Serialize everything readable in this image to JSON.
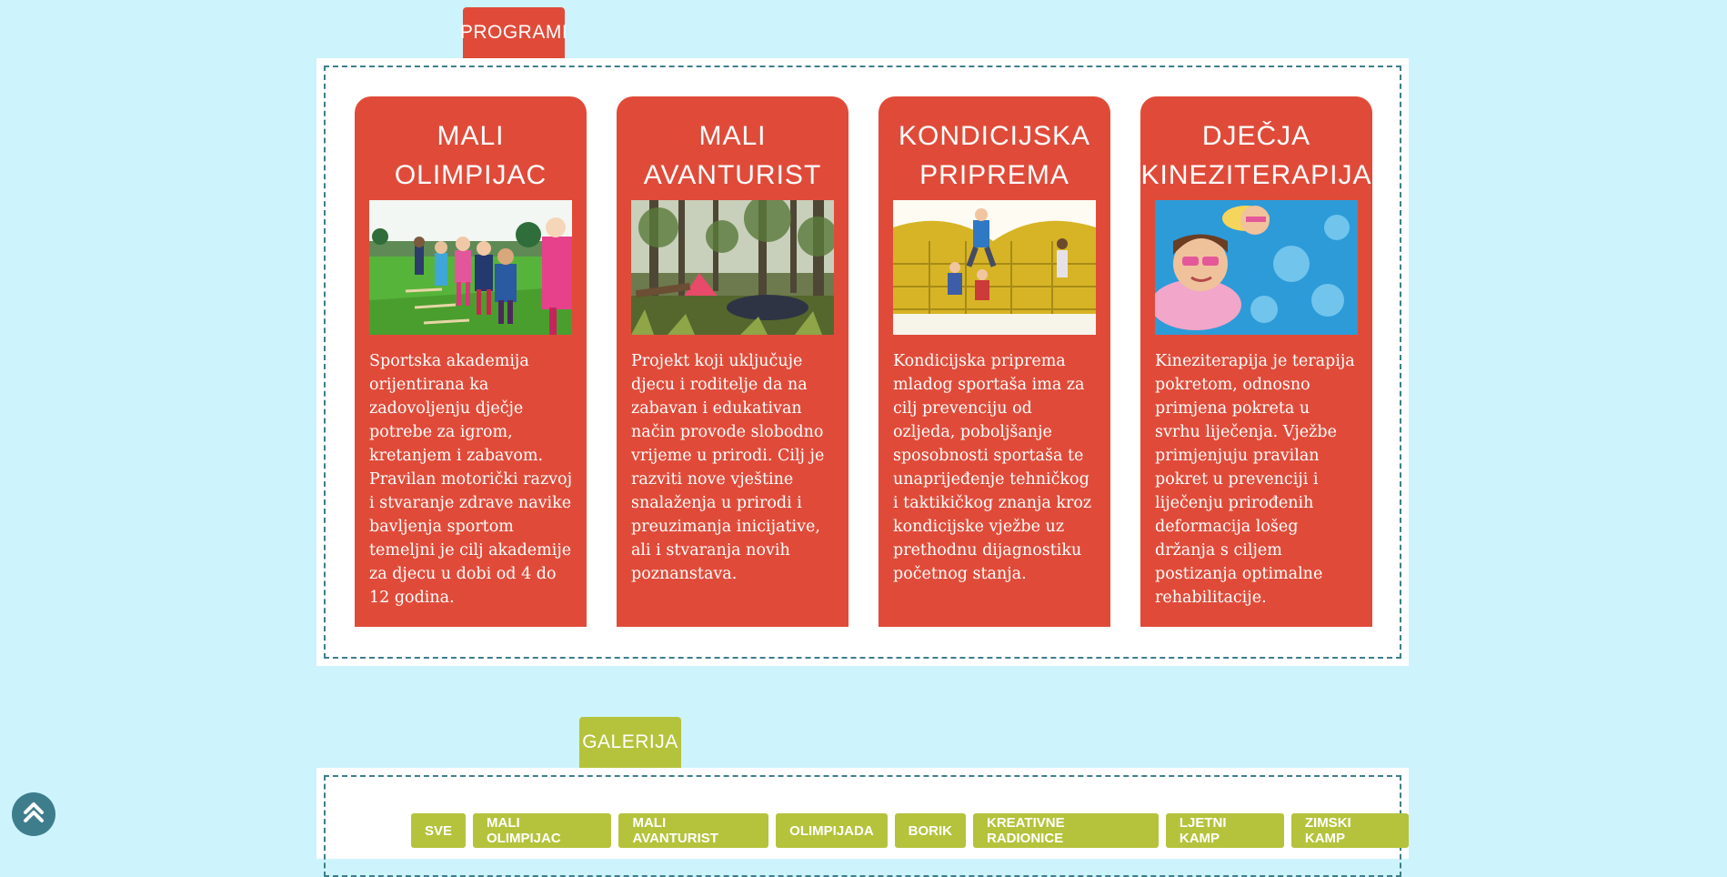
{
  "sections": {
    "programi_label": "PROGRAMI",
    "galerija_label": "GALERIJA"
  },
  "cards": [
    {
      "title_line1": "MALI",
      "title_line2": "OLIMPIJAC",
      "image": "children-on-grass-field",
      "text": "Sportska akademija orijentirana ka zadovoljenju dječje potrebe za igrom, kretanjem i zabavom. Pravilan motorički razvoj i stvaranje zdrave navike bavljenja sportom temeljni je cilj akademije za djecu u dobi od 4 do 12 godina."
    },
    {
      "title_line1": "MALI",
      "title_line2": "AVANTURIST",
      "image": "forest-camp-tent",
      "text": "Projekt koji uključuje djecu i roditelje da na zabavan i edukativan način provode slobodno vrijeme u prirodi. Cilj je razviti nove vještine snalaženja u prirodi i preuzimanja inicijative, ali i stvaranja novih poznanstava."
    },
    {
      "title_line1": "KONDICIJSKA",
      "title_line2": "PRIPREMA",
      "image": "bouncy-castle-jump",
      "text": "Kondicijska priprema mladog sportaša ima za cilj prevenciju od ozljeda, poboljšanje sposobnosti sportaša te unaprijeđenje tehničkog i taktikičkog znanja kroz kondicijske vježbe uz prethodnu dijagnostiku početnog stanja."
    },
    {
      "title_line1": "DJEČJA",
      "title_line2": "KINEZITERAPIJA",
      "image": "kids-in-pool",
      "text": "Kineziterapija je terapija pokretom, odnosno primjena pokreta u svrhu liječenja. Vježbe primjenjuju pravilan pokret u prevenciji i liječenju prirođenih deformacija lošeg držanja s ciljem postizanja optimalne rehabilitacije."
    }
  ],
  "gallery_filters": [
    "SVE",
    "MALI OLIMPIJAC",
    "MALI AVANTURIST",
    "OLIMPIJADA",
    "BORIK",
    "KREATIVNE RADIONICE",
    "LJETNI KAMP",
    "ZIMSKI KAMP"
  ],
  "colors": {
    "background": "#cdf3fd",
    "card_red": "#e04b39",
    "gallery_green": "#b5c33c",
    "dashed_border": "#3e7e8c"
  },
  "icons": {
    "scroll_top": "double-chevron-up-icon"
  }
}
